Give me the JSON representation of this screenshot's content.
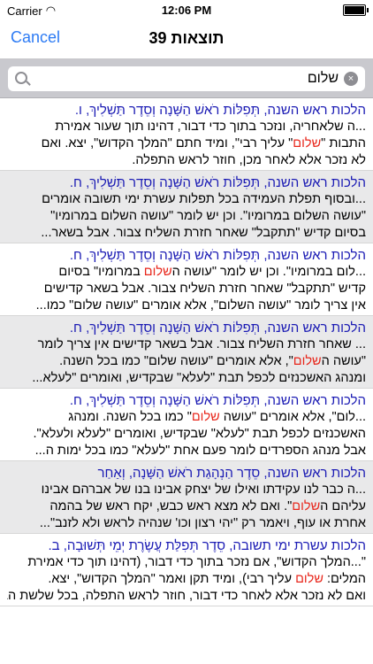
{
  "status": {
    "carrier": "Carrier",
    "time": "12:06 PM"
  },
  "nav": {
    "cancel": "Cancel",
    "title": "39 תוצאות"
  },
  "search": {
    "query": "שלום",
    "clear": "×"
  },
  "results": [
    {
      "head": "הלכות ראש השנה, תְּפִלּוֹת רֹאשׁ הַשָּׁנָה וְסֵדֶר תַּשְׁלִיךְ, ו.",
      "lines": [
        [
          "...ה שלאחריה, ונזכר בתוך כדי דבור, דהינו תוך שעור אמירת"
        ],
        [
          "התבות \"",
          "שלום",
          "\" עליך רבי\", ומיד חתם \"המלך הקדוש\", יצא. ואם"
        ],
        [
          "לא נזכר אלא לאחר מכן, חוזר לראש התפלה."
        ]
      ]
    },
    {
      "head": "הלכות ראש השנה, תְּפִלּוֹת רֹאשׁ הַשָּׁנָה וְסֵדֶר תַּשְׁלִיךְ, ח.",
      "lines": [
        [
          "...ובסוף תפלת העמידה בכל תפלות עשרת ימי תשובה אומרים"
        ],
        [
          "\"עושה השלום במרומיו\". וכן יש לומר \"עושה השלום במרומיו\""
        ],
        [
          "בסיום קדיש \"תתקבל\" שאחר חזרת השליח צבור. אבל בשאר..."
        ]
      ]
    },
    {
      "head": "הלכות ראש השנה, תְּפִלּוֹת רֹאשׁ הַשָּׁנָה וְסֵדֶר תַּשְׁלִיךְ, ח.",
      "lines": [
        [
          "...לום במרומיו\". וכן יש לומר \"עושה ה",
          "שלום",
          " במרומיו\" בסיום"
        ],
        [
          "קדיש \"תתקבל\" שאחר חזרת השליח צבור. אבל בשאר קדישים"
        ],
        [
          "אין צריך לומר \"עושה השלום\", אלא אומרים \"עושה שלום\" כמו..."
        ]
      ]
    },
    {
      "head": "הלכות ראש השנה, תְּפִלּוֹת רֹאשׁ הַשָּׁנָה וְסֵדֶר תַּשְׁלִיךְ, ח.",
      "lines": [
        [
          "... שאחר חזרת השליח צבור. אבל בשאר קדישים אין צריך לומר"
        ],
        [
          "\"עושה ה",
          "שלום",
          "\", אלא אומרים \"עושה שלום\" כמו בכל השנה."
        ],
        [
          "ומנהג האשכנזים לכפל תבת \"לעלא\" שבקדיש, ואומרים \"לעלא..."
        ]
      ]
    },
    {
      "head": "הלכות ראש השנה, תְּפִלּוֹת רֹאשׁ הַשָּׁנָה וְסֵדֶר תַּשְׁלִיךְ, ח.",
      "lines": [
        [
          "...לום\", אלא אומרים \"עושה ",
          "שלום",
          "\" כמו בכל השנה. ומנהג"
        ],
        [
          "האשכנזים לכפל תבת \"לעלא\" שבקדיש, ואומרים \"לעלא ולעלא\"."
        ],
        [
          "אבל מנהג הספרדים לומר פעם אחת \"לעלא\" כמו בכל ימות ה..."
        ]
      ]
    },
    {
      "head": "הלכות ראש השנה, סֵדֶר הַנְהָגַת רֹאשׁ הַשָּׁנָה, וְאַחַר",
      "lines": [
        [
          "...ה כבר לנו עקידתו ואילו של יצחק אבינו בנו של אברהם אבינו"
        ],
        [
          "עליהם ה",
          "שלום",
          "\". ואם לא מצא ראש כבש, יקח ראש של בהמה"
        ],
        [
          "אחרת או עוף, ויאמר רק \"יהי רצון וכו' שנהיה לראש ולא לזנב\"..."
        ]
      ]
    },
    {
      "head": "הלכות עשרת ימי תשובה, סֵדֶר תְּפִלַּת עֲשֶׂרֶת יְמֵי תְּשׁוּבָה, ב.",
      "lines": [
        [
          "\"...המלך הקדוש\", אם נזכר בתוך כדי דבור, (דהינו תוך כדי אמירת"
        ],
        [
          "המלים: ",
          "שלום",
          " עליך רבי), ומיד תקן ואמר \"המלך הקדוש\", יצא."
        ],
        [
          "ואם לא נזכר אלא לאחר כדי דבור, חוזר לראש התפלה, בכל שלשת הברכ..."
        ]
      ]
    }
  ]
}
